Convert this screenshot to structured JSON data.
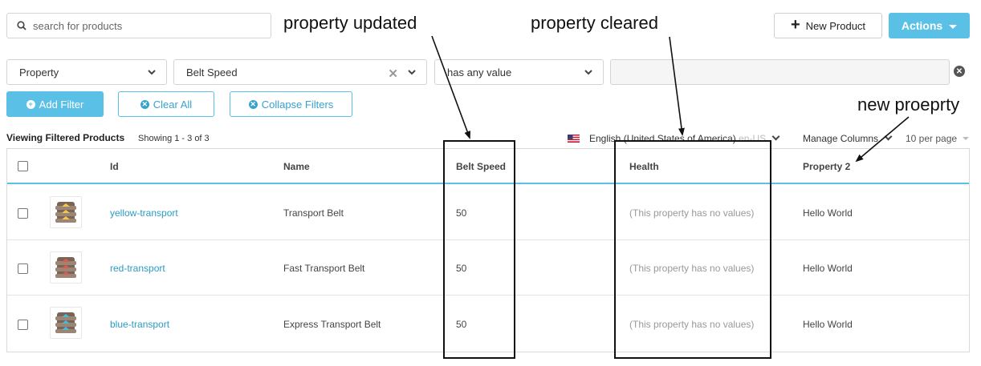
{
  "search": {
    "placeholder": "search for products"
  },
  "header": {
    "new_product_label": "New Product",
    "actions_label": "Actions"
  },
  "filter": {
    "property_select": "Property",
    "value_select": "Belt Speed",
    "condition_select": "has any value",
    "value_input": ""
  },
  "filter_actions": {
    "add_filter": "Add Filter",
    "clear_all": "Clear All",
    "collapse_filters": "Collapse Filters"
  },
  "status": {
    "viewing": "Viewing Filtered Products",
    "showing": "Showing 1 - 3 of 3",
    "language": "English (United States of America)",
    "language_suffix": "en-US",
    "manage_columns": "Manage Columns",
    "per_page": "10 per page"
  },
  "table": {
    "columns": [
      "Id",
      "Name",
      "Belt Speed",
      "Health",
      "Property 2"
    ],
    "rows": [
      {
        "id": "yellow-transport",
        "name": "Transport Belt",
        "belt_speed": "50",
        "health": "(This property has no values)",
        "property2": "Hello World",
        "color": "#f2c94c"
      },
      {
        "id": "red-transport",
        "name": "Fast Transport Belt",
        "belt_speed": "50",
        "health": "(This property has no values)",
        "property2": "Hello World",
        "color": "#e05a4f"
      },
      {
        "id": "blue-transport",
        "name": "Express Transport Belt",
        "belt_speed": "50",
        "health": "(This property has no values)",
        "property2": "Hello World",
        "color": "#4fb8d9"
      }
    ]
  },
  "annotations": {
    "property_updated": "property updated",
    "property_cleared": "property cleared",
    "new_property": "new proeprty"
  },
  "colors": {
    "accent": "#5bc0e6",
    "link": "#2a9cc4"
  }
}
